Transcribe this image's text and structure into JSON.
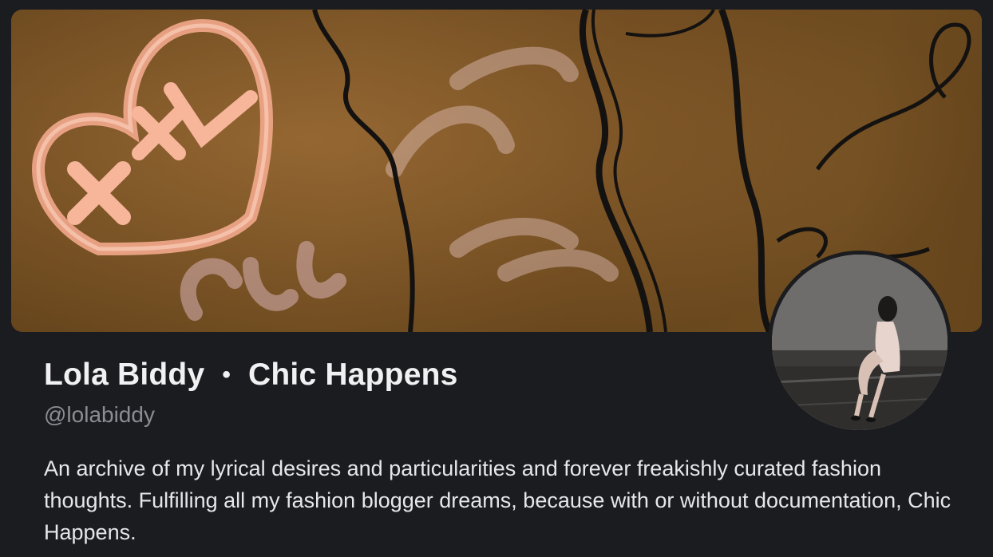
{
  "profile": {
    "display_name": "Lola Biddy",
    "separator": "•",
    "blog_title": "Chic Happens",
    "handle": "@lolabiddy",
    "bio": "An archive of my lyrical desires and particularities and forever freakishly curated fashion thoughts. Fulfilling all my fashion blogger dreams, because with or without documentation, Chic Happens."
  },
  "colors": {
    "background": "#1b1c1f",
    "name_text": "#f1f1f3",
    "handle_text": "#8b8d92",
    "bio_text": "#e6e7ea"
  }
}
